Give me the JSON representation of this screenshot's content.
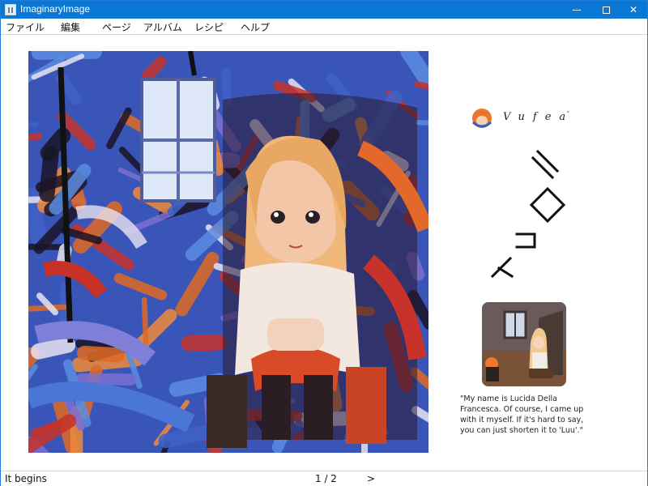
{
  "window": {
    "title": "ImaginaryImage",
    "controls": {
      "minimize_icon": "minimize-icon",
      "maximize_icon": "maximize-icon",
      "close_label": "✕"
    }
  },
  "menu": {
    "items": [
      {
        "label": "ファイル"
      },
      {
        "label": "編集"
      },
      {
        "label": "ページ"
      },
      {
        "label": "アルバム"
      },
      {
        "label": "レシピ"
      },
      {
        "label": "ヘルプ"
      }
    ]
  },
  "main_image": {
    "icon": "painted-portrait-image",
    "colors": {
      "blue": "#3f63c8",
      "violet": "#7a6fd0",
      "orange": "#e06a24",
      "red": "#c8322a",
      "dark": "#1a1426",
      "hair": "#f0b878"
    }
  },
  "author": {
    "name": "Vufea",
    "avatar_icon": "author-avatar-icon",
    "chevron": "˅"
  },
  "vertical_title": {
    "text": "ト ロ ミ",
    "icon": "stylized-katakana-title"
  },
  "thumbnail": {
    "icon": "girl-in-cabin-thumbnail"
  },
  "quote": {
    "text": "\"My name is Lucida Della Francesca. Of course, I came up with it myself. If it's hard to say, you can just shorten it to 'Luu'.\""
  },
  "status": {
    "left_text": "It begins",
    "page": "1 / 2",
    "next_label": ">"
  }
}
